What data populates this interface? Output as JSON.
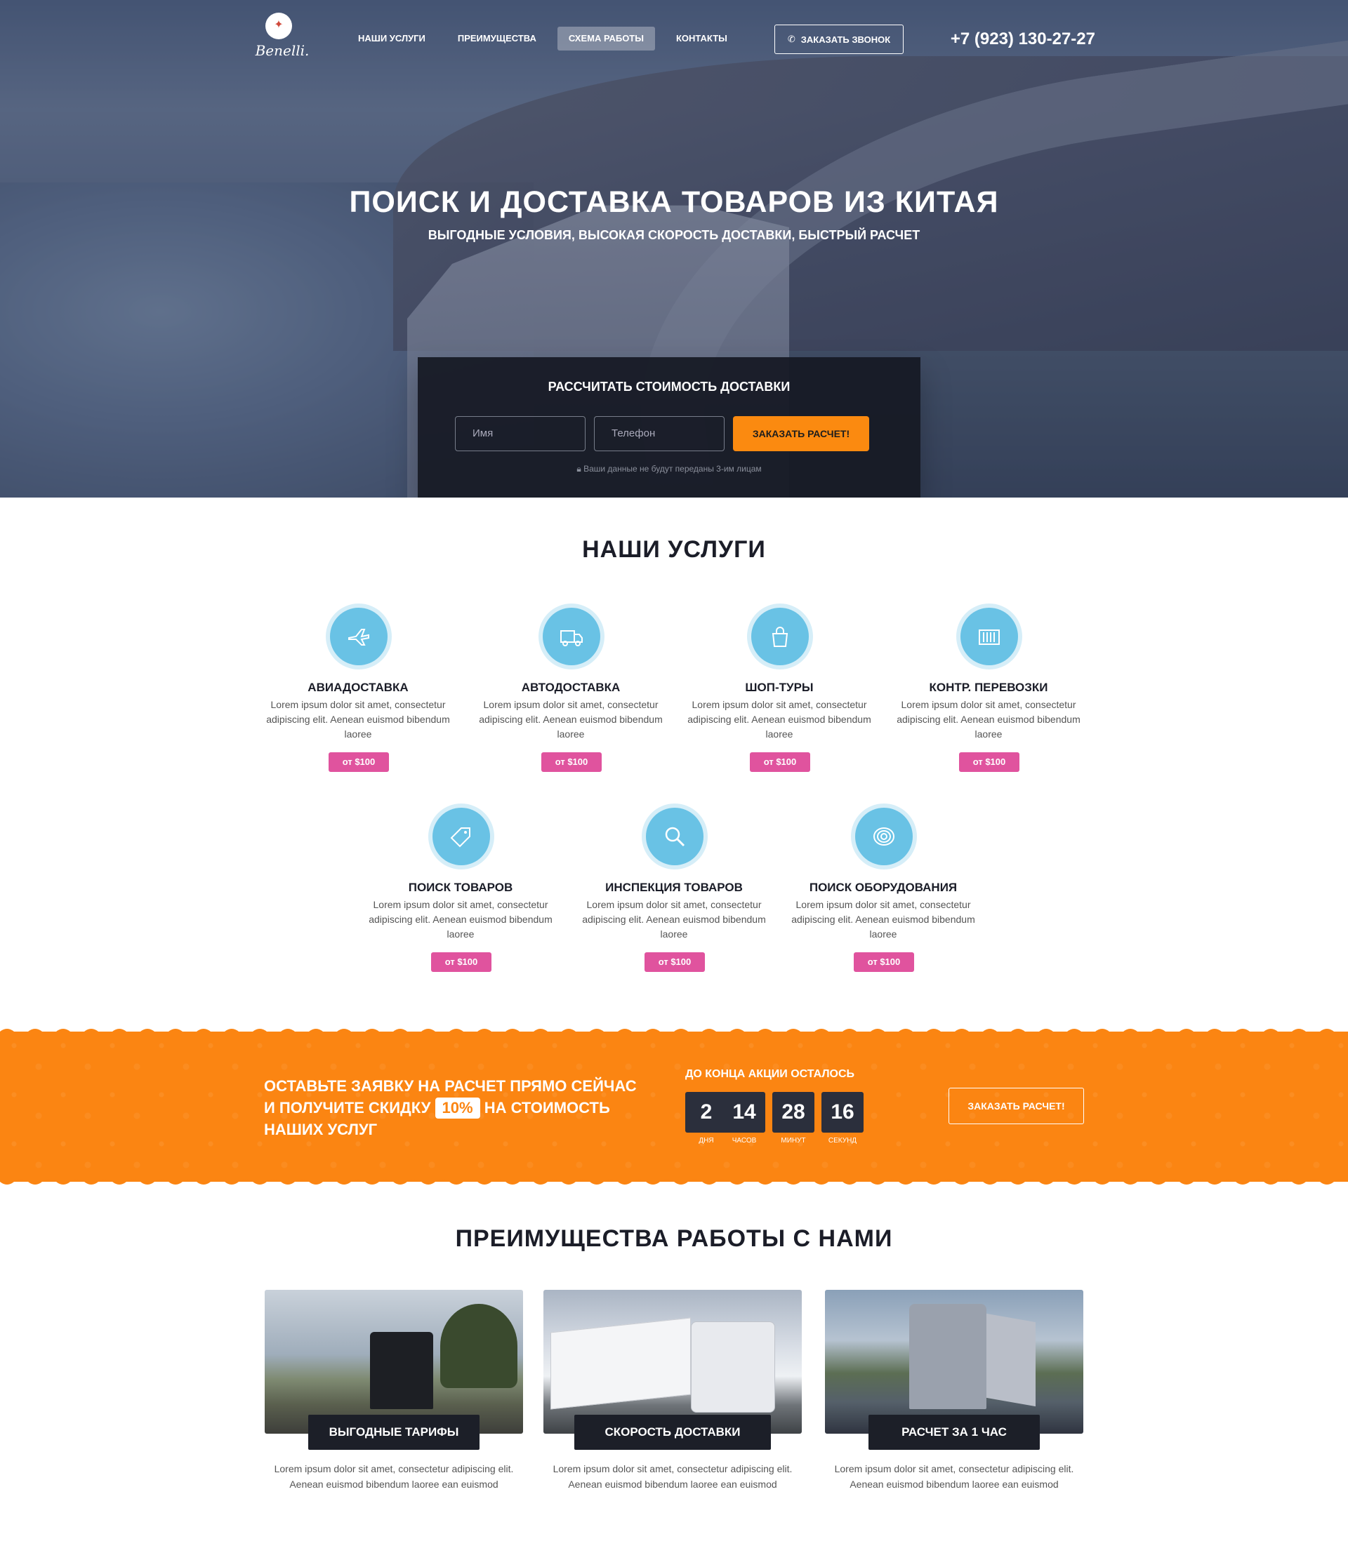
{
  "brand": {
    "name": "Benelli."
  },
  "nav": {
    "items": [
      {
        "label": "НАШИ УСЛУГИ",
        "active": false
      },
      {
        "label": "ПРЕИМУЩЕСТВА",
        "active": false
      },
      {
        "label": "СХЕМА РАБОТЫ",
        "active": true
      },
      {
        "label": "КОНТАКТЫ",
        "active": false
      }
    ],
    "call_button": "ЗАКАЗАТЬ ЗВОНОК",
    "phone": "+7 (923) 130-27-27"
  },
  "hero": {
    "title": "ПОИСК И ДОСТАВКА ТОВАРОВ ИЗ КИТАЯ",
    "subtitle": "ВЫГОДНЫЕ УСЛОВИЯ, ВЫСОКАЯ СКОРОСТЬ ДОСТАВКИ, БЫСТРЫЙ РАСЧЕТ"
  },
  "form": {
    "title": "РАССЧИТАТЬ СТОИМОСТЬ ДОСТАВКИ",
    "name_placeholder": "Имя",
    "phone_placeholder": "Телефон",
    "submit": "ЗАКАЗАТЬ РАСЧЕТ!",
    "privacy": "Ваши данные не будут переданы 3-им лицам"
  },
  "services": {
    "title": "НАШИ УСЛУГИ",
    "items": [
      {
        "name": "АВИАДОСТАВКА",
        "desc": "Lorem ipsum dolor sit amet, consectetur adipiscing elit. Aenean euismod bibendum laoree",
        "price": "от $100",
        "icon": "airplane-icon"
      },
      {
        "name": "АВТОДОСТАВКА",
        "desc": "Lorem ipsum dolor sit amet, consectetur adipiscing elit. Aenean euismod bibendum laoree",
        "price": "от $100",
        "icon": "truck-icon"
      },
      {
        "name": "ШОП-ТУРЫ",
        "desc": "Lorem ipsum dolor sit amet, consectetur adipiscing elit. Aenean euismod bibendum laoree",
        "price": "от $100",
        "icon": "shopping-bag-icon"
      },
      {
        "name": "КОНТР. ПЕРЕВОЗКИ",
        "desc": "Lorem ipsum dolor sit amet, consectetur adipiscing elit. Aenean euismod bibendum laoree",
        "price": "от $100",
        "icon": "container-icon"
      },
      {
        "name": "ПОИСК ТОВАРОВ",
        "desc": "Lorem ipsum dolor sit amet, consectetur adipiscing elit. Aenean euismod bibendum laoree",
        "price": "от $100",
        "icon": "tag-icon"
      },
      {
        "name": "ИНСПЕКЦИЯ ТОВАРОВ",
        "desc": "Lorem ipsum dolor sit amet, consectetur adipiscing elit. Aenean euismod bibendum laoree",
        "price": "от $100",
        "icon": "magnifier-icon"
      },
      {
        "name": "ПОИСК ОБОРУДОВАНИЯ",
        "desc": "Lorem ipsum dolor sit amet, consectetur adipiscing elit. Aenean euismod bibendum laoree",
        "price": "от $100",
        "icon": "coil-icon"
      }
    ]
  },
  "promo": {
    "line1": "ОСТАВЬТЕ ЗАЯВКУ НА РАСЧЕТ ПРЯМО СЕЙЧАС",
    "line2_before": "И ПОЛУЧИТЕ СКИДКУ",
    "discount": "10%",
    "line2_after": "НА СТОИМОСТЬ",
    "line3": "НАШИХ УСЛУГ",
    "timer_title": "ДО КОНЦА АКЦИИ ОСТАЛОСЬ",
    "timer": [
      {
        "value": "2",
        "label": "ДНЯ"
      },
      {
        "value": "14",
        "label": "ЧАСОВ"
      },
      {
        "value": "28",
        "label": "МИНУТ"
      },
      {
        "value": "16",
        "label": "СЕКУНД"
      }
    ],
    "button": "ЗАКАЗАТЬ РАСЧЕТ!"
  },
  "advantages": {
    "title": "ПРЕИМУЩЕСТВА РАБОТЫ С НАМИ",
    "items": [
      {
        "label": "ВЫГОДНЫЕ ТАРИФЫ",
        "text": "Lorem ipsum dolor sit amet, consectetur adipiscing elit. Aenean euismod bibendum laoree ean euismod"
      },
      {
        "label": "СКОРОСТЬ ДОСТАВКИ",
        "text": "Lorem ipsum dolor sit amet, consectetur adipiscing elit. Aenean euismod bibendum laoree ean euismod"
      },
      {
        "label": "РАСЧЕТ ЗА 1 ЧАС",
        "text": "Lorem ipsum dolor sit amet, consectetur adipiscing elit. Aenean euismod bibendum laoree ean euismod"
      }
    ]
  },
  "colors": {
    "accent": "#fb8512",
    "price_badge": "#e0539e",
    "icon_circle": "#69c2e5",
    "dark": "#1c1f28"
  }
}
